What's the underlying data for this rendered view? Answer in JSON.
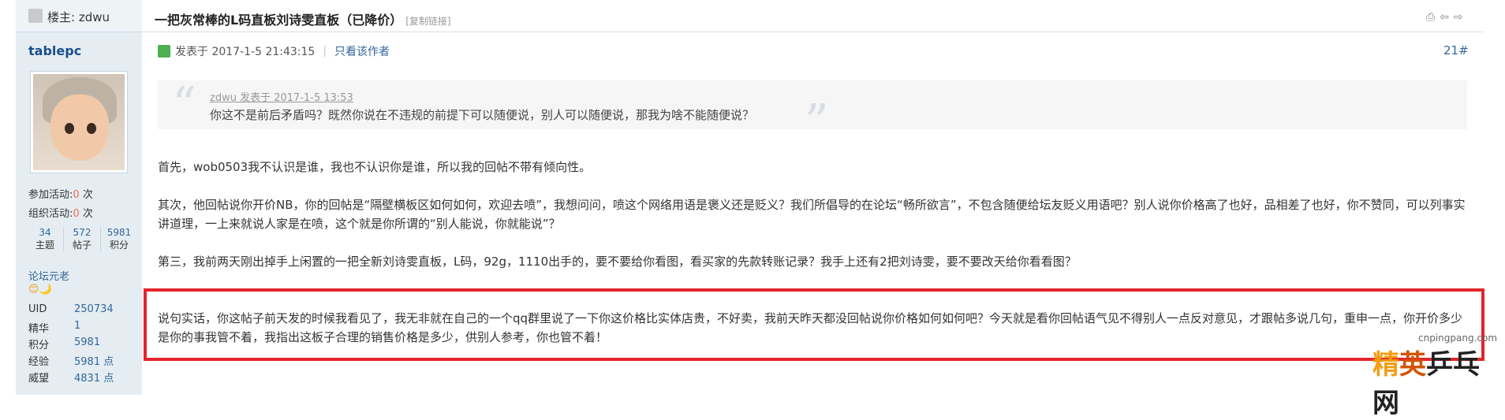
{
  "sidebar": {
    "owner_label": "楼主: zdwu",
    "username": "tablepc",
    "stats": [
      {
        "label": "参加活动:",
        "value": "0",
        "unit": "次"
      },
      {
        "label": "组织活动:",
        "value": "0",
        "unit": "次"
      }
    ],
    "counts": [
      {
        "value": "34",
        "label": "主题"
      },
      {
        "value": "572",
        "label": "帖子"
      },
      {
        "value": "5981",
        "label": "积分"
      }
    ],
    "rank": "论坛元老",
    "medals": "😊🌙",
    "info": [
      {
        "key": "UID",
        "value": "250734"
      },
      {
        "key": "精华",
        "value": "1"
      },
      {
        "key": "积分",
        "value": "5981"
      },
      {
        "key": "经验",
        "value": "5981 点"
      },
      {
        "key": "威望",
        "value": "4831 点"
      }
    ]
  },
  "thread": {
    "title": "一把灰常棒的L码直板刘诗雯直板（已降价）",
    "copy_link": "[复制链接]",
    "title_icons": "⎙⇦⇨"
  },
  "post": {
    "posted": "发表于 2017-1-5 21:43:15",
    "author_only": "只看该作者",
    "floor": "21#",
    "quote": {
      "source": "zdwu 发表于 2017-1-5 13:53",
      "text": "你这不是前后矛盾吗？既然你说在不违规的前提下可以随便说，别人可以随便说，那我为啥不能随便说？"
    },
    "paragraphs": [
      "首先，wob0503我不认识是谁，我也不认识你是谁，所以我的回帖不带有倾向性。",
      "其次，他回帖说你开价NB，你的回帖是“隔壁横板区如何如何，欢迎去喷”，我想问问，喷这个网络用语是褒义还是贬义？我们所倡导的在论坛“畅所欲言”，不包含随便给坛友贬义用语吧？别人说你价格高了也好，品相差了也好，你不赞同，可以列事实讲道理，一上来就说人家是在喷，这个就是你所谓的“别人能说，你就能说”？",
      "第三，我前两天刚出掉手上闲置的一把全新刘诗雯直板，L码，92g，1110出手的，要不要给你看图，看买家的先款转账记录？我手上还有2把刘诗雯，要不要改天给你看看图？",
      "说句实话，你这帖子前天发的时候我看见了，我无非就在自己的一个qq群里说了一下你这价格比实体店贵，不好卖，我前天昨天都没回帖说你价格如何如何吧？今天就是看你回帖语气见不得别人一点反对意见，才跟帖多说几句，重申一点，你开价多少是你的事我管不着，我指出这板子合理的销售价格是多少，供别人参考，你也管不着！"
    ]
  },
  "watermark": {
    "site": "cnpingpang.com",
    "logo_a": "精",
    "logo_b": "英",
    "logo_c": "乒乓网"
  },
  "colors": {
    "highlight": "#e3242b",
    "link": "#336699",
    "sidebar_bg": "#e5edf2"
  }
}
